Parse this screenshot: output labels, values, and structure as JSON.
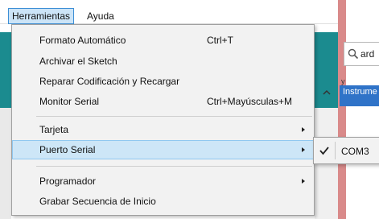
{
  "menubar": {
    "items": [
      {
        "label": "Herramientas"
      },
      {
        "label": "Ayuda"
      }
    ]
  },
  "background": {
    "search_value": "ard",
    "panel_label": "y",
    "highlighted_item": "Instrume"
  },
  "menu": {
    "items": [
      {
        "label": "Formato Automático",
        "shortcut": "Ctrl+T"
      },
      {
        "label": "Archivar el Sketch",
        "shortcut": ""
      },
      {
        "label": "Reparar Codificación y Recargar",
        "shortcut": ""
      },
      {
        "label": "Monitor Serial",
        "shortcut": "Ctrl+Mayúsculas+M"
      },
      {
        "label": "Tarjeta",
        "shortcut": ""
      },
      {
        "label": "Puerto Serial",
        "shortcut": ""
      },
      {
        "label": "Programador",
        "shortcut": ""
      },
      {
        "label": "Grabar Secuencia de Inicio",
        "shortcut": ""
      }
    ]
  },
  "submenu": {
    "items": [
      {
        "label": "COM3",
        "checked": true
      }
    ]
  },
  "icons": {
    "search": "search-icon",
    "check": "checkmark-icon",
    "submenu_arrow": "chevron-right-icon",
    "scroll": "chevron-up-icon"
  },
  "colors": {
    "highlight": "#cde6f7",
    "highlight_border": "#90c8f0",
    "teal": "#1b8b8f",
    "selection": "#2f73c8"
  }
}
